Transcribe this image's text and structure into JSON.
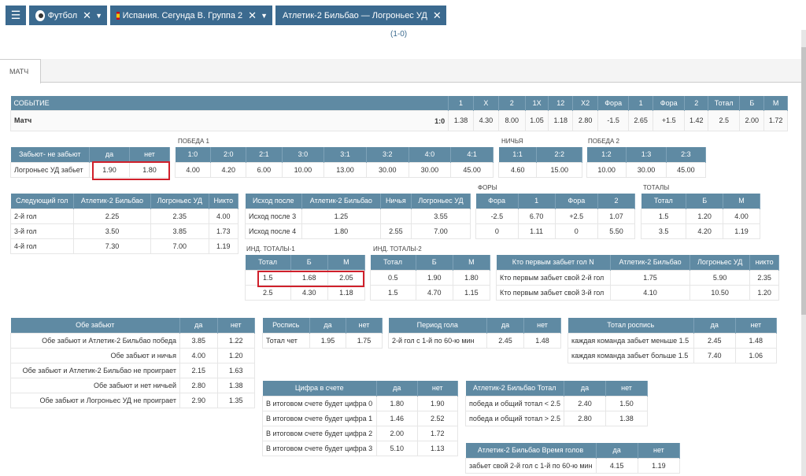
{
  "nav": {
    "sport": "Футбол",
    "league": "Испания. Сегунда В. Группа 2",
    "match": "Атлетик-2 Бильбао — Логроньес УД",
    "score": "(1-0)"
  },
  "tab": "МАТЧ",
  "event": {
    "headers": [
      "СОБЫТИЕ",
      "1",
      "Х",
      "2",
      "1Х",
      "12",
      "Х2",
      "Фора",
      "1",
      "Фора",
      "2",
      "Тотал",
      "Б",
      "М"
    ],
    "row": [
      "Матч",
      "1:0",
      "1.38",
      "4.30",
      "8.00",
      "1.05",
      "1.18",
      "2.80",
      "-1.5",
      "2.65",
      "+1.5",
      "1.42",
      "2.5",
      "2.00",
      "1.72"
    ]
  },
  "sections": {
    "pobeda1": "ПОБЕДА 1",
    "nichya": "НИЧЬЯ",
    "pobeda2": "ПОБЕДА 2",
    "fory": "ФОРЫ",
    "totaly": "ТОТАЛЫ",
    "ind1": "ИНД. ТОТАЛЫ-1",
    "ind2": "ИНД. ТОТАЛЫ-2"
  },
  "t_zab": {
    "h": [
      "Забьют- не забьют",
      "да",
      "нет"
    ],
    "rows": [
      [
        "Логроньес УД забьет",
        "1.90",
        "1.80"
      ]
    ]
  },
  "t_p1": {
    "h": [
      "1:0",
      "2:0",
      "2:1",
      "3:0",
      "3:1",
      "3:2",
      "4:0",
      "4:1"
    ],
    "rows": [
      [
        "4.00",
        "4.20",
        "6.00",
        "10.00",
        "13.00",
        "30.00",
        "30.00",
        "45.00"
      ]
    ]
  },
  "t_nich": {
    "h": [
      "1:1",
      "2:2"
    ],
    "rows": [
      [
        "4.60",
        "15.00"
      ]
    ]
  },
  "t_p2": {
    "h": [
      "1:2",
      "1:3",
      "2:3"
    ],
    "rows": [
      [
        "10.00",
        "30.00",
        "45.00"
      ]
    ]
  },
  "t_next": {
    "h": [
      "Следующий гол",
      "Атлетик-2 Бильбао",
      "Логроньес УД",
      "Никто"
    ],
    "rows": [
      [
        "2-й гол",
        "2.25",
        "2.35",
        "4.00"
      ],
      [
        "3-й гол",
        "3.50",
        "3.85",
        "1.73"
      ],
      [
        "4-й гол",
        "7.30",
        "7.00",
        "1.19"
      ]
    ]
  },
  "t_ishod": {
    "h": [
      "Исход после",
      "Атлетик-2 Бильбао",
      "Ничья",
      "Логроньес УД"
    ],
    "rows": [
      [
        "Исход после 3",
        "1.25",
        "",
        "3.55"
      ],
      [
        "Исход после 4",
        "1.80",
        "2.55",
        "7.00"
      ]
    ]
  },
  "t_fory": {
    "h": [
      "Фора",
      "1",
      "Фора",
      "2"
    ],
    "rows": [
      [
        "-2.5",
        "6.70",
        "+2.5",
        "1.07"
      ],
      [
        "0",
        "1.11",
        "0",
        "5.50"
      ]
    ]
  },
  "t_total": {
    "h": [
      "Тотал",
      "Б",
      "М"
    ],
    "rows": [
      [
        "1.5",
        "1.20",
        "4.00"
      ],
      [
        "3.5",
        "4.20",
        "1.19"
      ]
    ]
  },
  "t_ind1": {
    "h": [
      "Тотал",
      "Б",
      "М"
    ],
    "rows": [
      [
        "1.5",
        "1.68",
        "2.05"
      ],
      [
        "2.5",
        "4.30",
        "1.18"
      ]
    ]
  },
  "t_ind2": {
    "h": [
      "Тотал",
      "Б",
      "М"
    ],
    "rows": [
      [
        "0.5",
        "1.90",
        "1.80"
      ],
      [
        "1.5",
        "4.70",
        "1.15"
      ]
    ]
  },
  "t_first": {
    "h": [
      "Кто первым забьет гол N",
      "Атлетик-2 Бильбао",
      "Логроньес УД",
      "никто"
    ],
    "rows": [
      [
        "Кто первым забьет свой 2-й гол",
        "1.75",
        "5.90",
        "2.35"
      ],
      [
        "Кто первым забьет свой 3-й гол",
        "4.10",
        "10.50",
        "1.20"
      ]
    ]
  },
  "t_obe": {
    "h": [
      "Обе забьют",
      "да",
      "нет"
    ],
    "rows": [
      [
        "Обе забьют и Атлетик-2 Бильбао победа",
        "3.85",
        "1.22"
      ],
      [
        "Обе забьют и ничья",
        "4.00",
        "1.20"
      ],
      [
        "Обе забьют и Атлетик-2 Бильбао не проиграет",
        "2.15",
        "1.63"
      ],
      [
        "Обе забьют и нет ничьей",
        "2.80",
        "1.38"
      ],
      [
        "Обе забьют и Логроньес УД не проиграет",
        "2.90",
        "1.35"
      ]
    ]
  },
  "t_rosp": {
    "h": [
      "Роспись",
      "да",
      "нет"
    ],
    "rows": [
      [
        "Тотал чет",
        "1.95",
        "1.75"
      ]
    ]
  },
  "t_period": {
    "h": [
      "Период гола",
      "да",
      "нет"
    ],
    "rows": [
      [
        "2-й гол с 1-й по 60-ю мин",
        "2.45",
        "1.48"
      ]
    ]
  },
  "t_trosp": {
    "h": [
      "Тотал роспись",
      "да",
      "нет"
    ],
    "rows": [
      [
        "каждая команда забьет меньше 1.5",
        "2.45",
        "1.48"
      ],
      [
        "каждая команда забьет больше 1.5",
        "7.40",
        "1.06"
      ]
    ]
  },
  "t_cifra": {
    "h": [
      "Цифра в счете",
      "да",
      "нет"
    ],
    "rows": [
      [
        "В итоговом счете будет цифра 0",
        "1.80",
        "1.90"
      ],
      [
        "В итоговом счете будет цифра 1",
        "1.46",
        "2.52"
      ],
      [
        "В итоговом счете будет цифра 2",
        "2.00",
        "1.72"
      ],
      [
        "В итоговом счете будет цифра 3",
        "5.10",
        "1.13"
      ]
    ]
  },
  "t_atot": {
    "h": [
      "Атлетик-2 Бильбао Тотал",
      "да",
      "нет"
    ],
    "rows": [
      [
        "победа и общий тотал < 2.5",
        "2.40",
        "1.50"
      ],
      [
        "победа и общий тотал > 2.5",
        "2.80",
        "1.38"
      ]
    ]
  },
  "t_atime": {
    "h": [
      "Атлетик-2 Бильбао Время голов",
      "да",
      "нет"
    ],
    "rows": [
      [
        "забьет свой 2-й гол с 1-й по 60-ю мин",
        "4.15",
        "1.19"
      ]
    ]
  }
}
